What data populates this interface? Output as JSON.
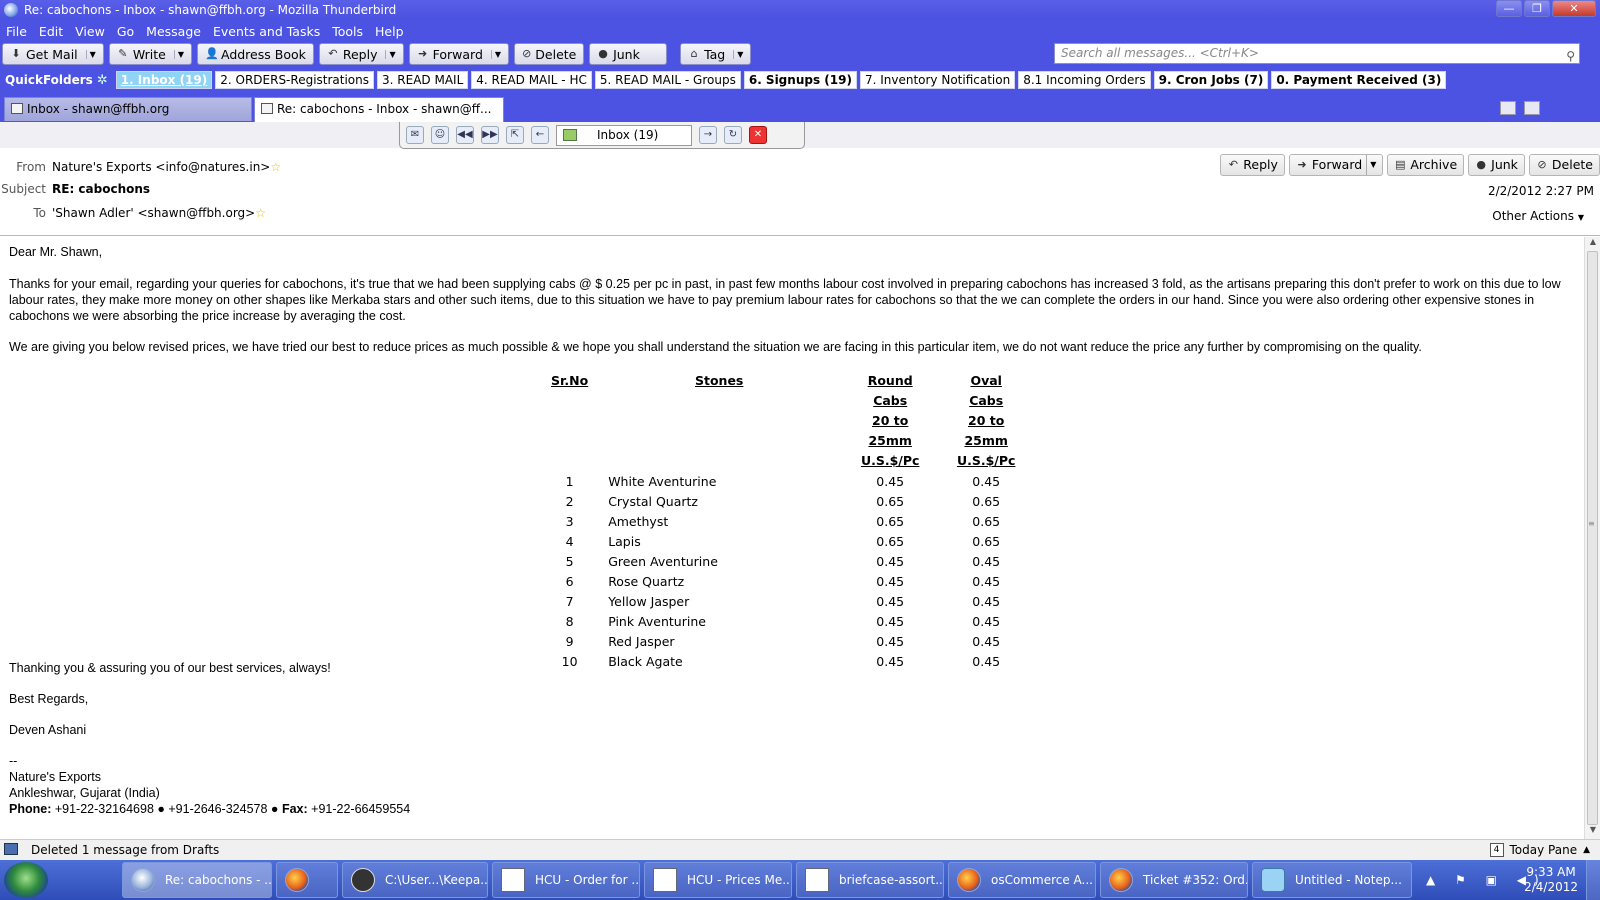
{
  "window": {
    "title": "Re: cabochons - Inbox - shawn@ffbh.org - Mozilla Thunderbird",
    "controls": [
      "—",
      "❐",
      "✕"
    ]
  },
  "menu": [
    "File",
    "Edit",
    "View",
    "Go",
    "Message",
    "Events and Tasks",
    "Tools",
    "Help"
  ],
  "toolbar": {
    "get_mail": "Get Mail",
    "write": "Write",
    "address_book": "Address Book",
    "reply": "Reply",
    "forward": "Forward",
    "delete": "Delete",
    "junk": "Junk",
    "tag": "Tag",
    "search_placeholder": "Search all messages... <Ctrl+K>"
  },
  "quickfolders": {
    "label": "QuickFolders",
    "tabs": [
      {
        "label": "1. Inbox (19)",
        "active": true,
        "bold": true
      },
      {
        "label": "2. ORDERS-Registrations",
        "bold": false
      },
      {
        "label": "3. READ MAIL",
        "bold": false
      },
      {
        "label": "4. READ MAIL - HC",
        "bold": false
      },
      {
        "label": "5. READ MAIL - Groups",
        "bold": false
      },
      {
        "label": "6. Signups (19)",
        "bold": true
      },
      {
        "label": "7. Inventory Notification",
        "bold": false
      },
      {
        "label": "8.1 Incoming Orders",
        "bold": false
      },
      {
        "label": "9. Cron Jobs (7)",
        "bold": true
      },
      {
        "label": "0. Payment Received (3)",
        "bold": true
      }
    ]
  },
  "tabs": [
    {
      "label": "Inbox - shawn@ffbh.org"
    },
    {
      "label": "Re: cabochons - Inbox - shawn@ff...",
      "close": "×"
    }
  ],
  "floatbar": {
    "folder": "Inbox (19)"
  },
  "header": {
    "from_label": "From",
    "from": "Nature's Exports <info@natures.in>",
    "subject_label": "Subject",
    "subject": "RE: cabochons",
    "to_label": "To",
    "to": "'Shawn Adler' <shawn@ffbh.org>",
    "date": "2/2/2012 2:27 PM",
    "other_actions": "Other Actions",
    "actions": {
      "reply": "Reply",
      "forward": "Forward",
      "archive": "Archive",
      "junk": "Junk",
      "delete": "Delete"
    }
  },
  "body": {
    "greeting": "Dear Mr. Shawn,",
    "para1": "Thanks for your email, regarding your queries for cabochons, it's true that we had been supplying cabs @ $ 0.25 per pc in past, in past few months labour cost involved in preparing cabochons has increased 3 fold, as the artisans preparing this don't prefer to work on this due to low labour rates, they make more money on other shapes like Merkaba stars and other such items, due to this situation we have to pay premium labour rates for cabochons so that the we can complete the orders in our hand. Since you were also ordering other expensive stones in cabochons we were absorbing the price increase by averaging the cost.",
    "para2": "We are giving you below revised prices, we have tried our best to reduce prices as much possible & we hope you shall understand the situation we are facing in this particular item, we do not want reduce the price any further by compromising on the quality.",
    "table": {
      "headers": [
        "Sr.No",
        "Stones",
        "Round\nCabs\n20 to 25mm\nU.S.$/Pc",
        "Oval\nCabs\n20 to 25mm\nU.S.$/Pc"
      ],
      "rows": [
        [
          "1",
          "White Aventurine",
          "0.45",
          "0.45"
        ],
        [
          "2",
          "Crystal Quartz",
          "0.65",
          "0.65"
        ],
        [
          "3",
          "Amethyst",
          "0.65",
          "0.65"
        ],
        [
          "4",
          "Lapis",
          "0.65",
          "0.65"
        ],
        [
          "5",
          "Green Aventurine",
          "0.45",
          "0.45"
        ],
        [
          "6",
          "Rose Quartz",
          "0.45",
          "0.45"
        ],
        [
          "7",
          "Yellow Jasper",
          "0.45",
          "0.45"
        ],
        [
          "8",
          "Pink Aventurine",
          "0.45",
          "0.45"
        ],
        [
          "9",
          "Red Jasper",
          "0.45",
          "0.45"
        ],
        [
          "10",
          "Black Agate",
          "0.45",
          "0.45"
        ]
      ]
    },
    "thanks": "Thanking you & assuring you of our best services, always!",
    "regards": "Best Regards,",
    "name": "Deven Ashani",
    "sig_sep": "--",
    "company": "Nature's Exports",
    "address": "Ankleshwar, Gujarat (India)",
    "phone_label": "Phone:",
    "phone": "+91-22-32164698 ● +91-2646-324578 ●",
    "fax_label": "Fax:",
    "fax": "+91-22-66459554"
  },
  "status": {
    "text": "Deleted 1 message from Drafts",
    "today_pane": "Today Pane",
    "cal_day": "4"
  },
  "taskbar": {
    "items": [
      {
        "label": "Re: cabochons - ...",
        "icon": "thunderbird-icon"
      },
      {
        "label": "",
        "icon": "firefox-icon"
      },
      {
        "label": "C:\\User...\\Keepa...",
        "icon": "keepass-icon"
      },
      {
        "label": "HCU - Order for ...",
        "icon": "document-icon"
      },
      {
        "label": "HCU - Prices Me...",
        "icon": "document-icon"
      },
      {
        "label": "briefcase-assort...",
        "icon": "document-icon"
      },
      {
        "label": "osCommerce A...",
        "icon": "firefox-icon"
      },
      {
        "label": "Ticket #352: Ord...",
        "icon": "firefox-icon"
      },
      {
        "label": "Untitled - Notep...",
        "icon": "notepad-icon"
      }
    ],
    "time": "9:33 AM",
    "date": "2/4/2012",
    "tray_icons": "▲ ⚑ ▣ ◀)"
  }
}
